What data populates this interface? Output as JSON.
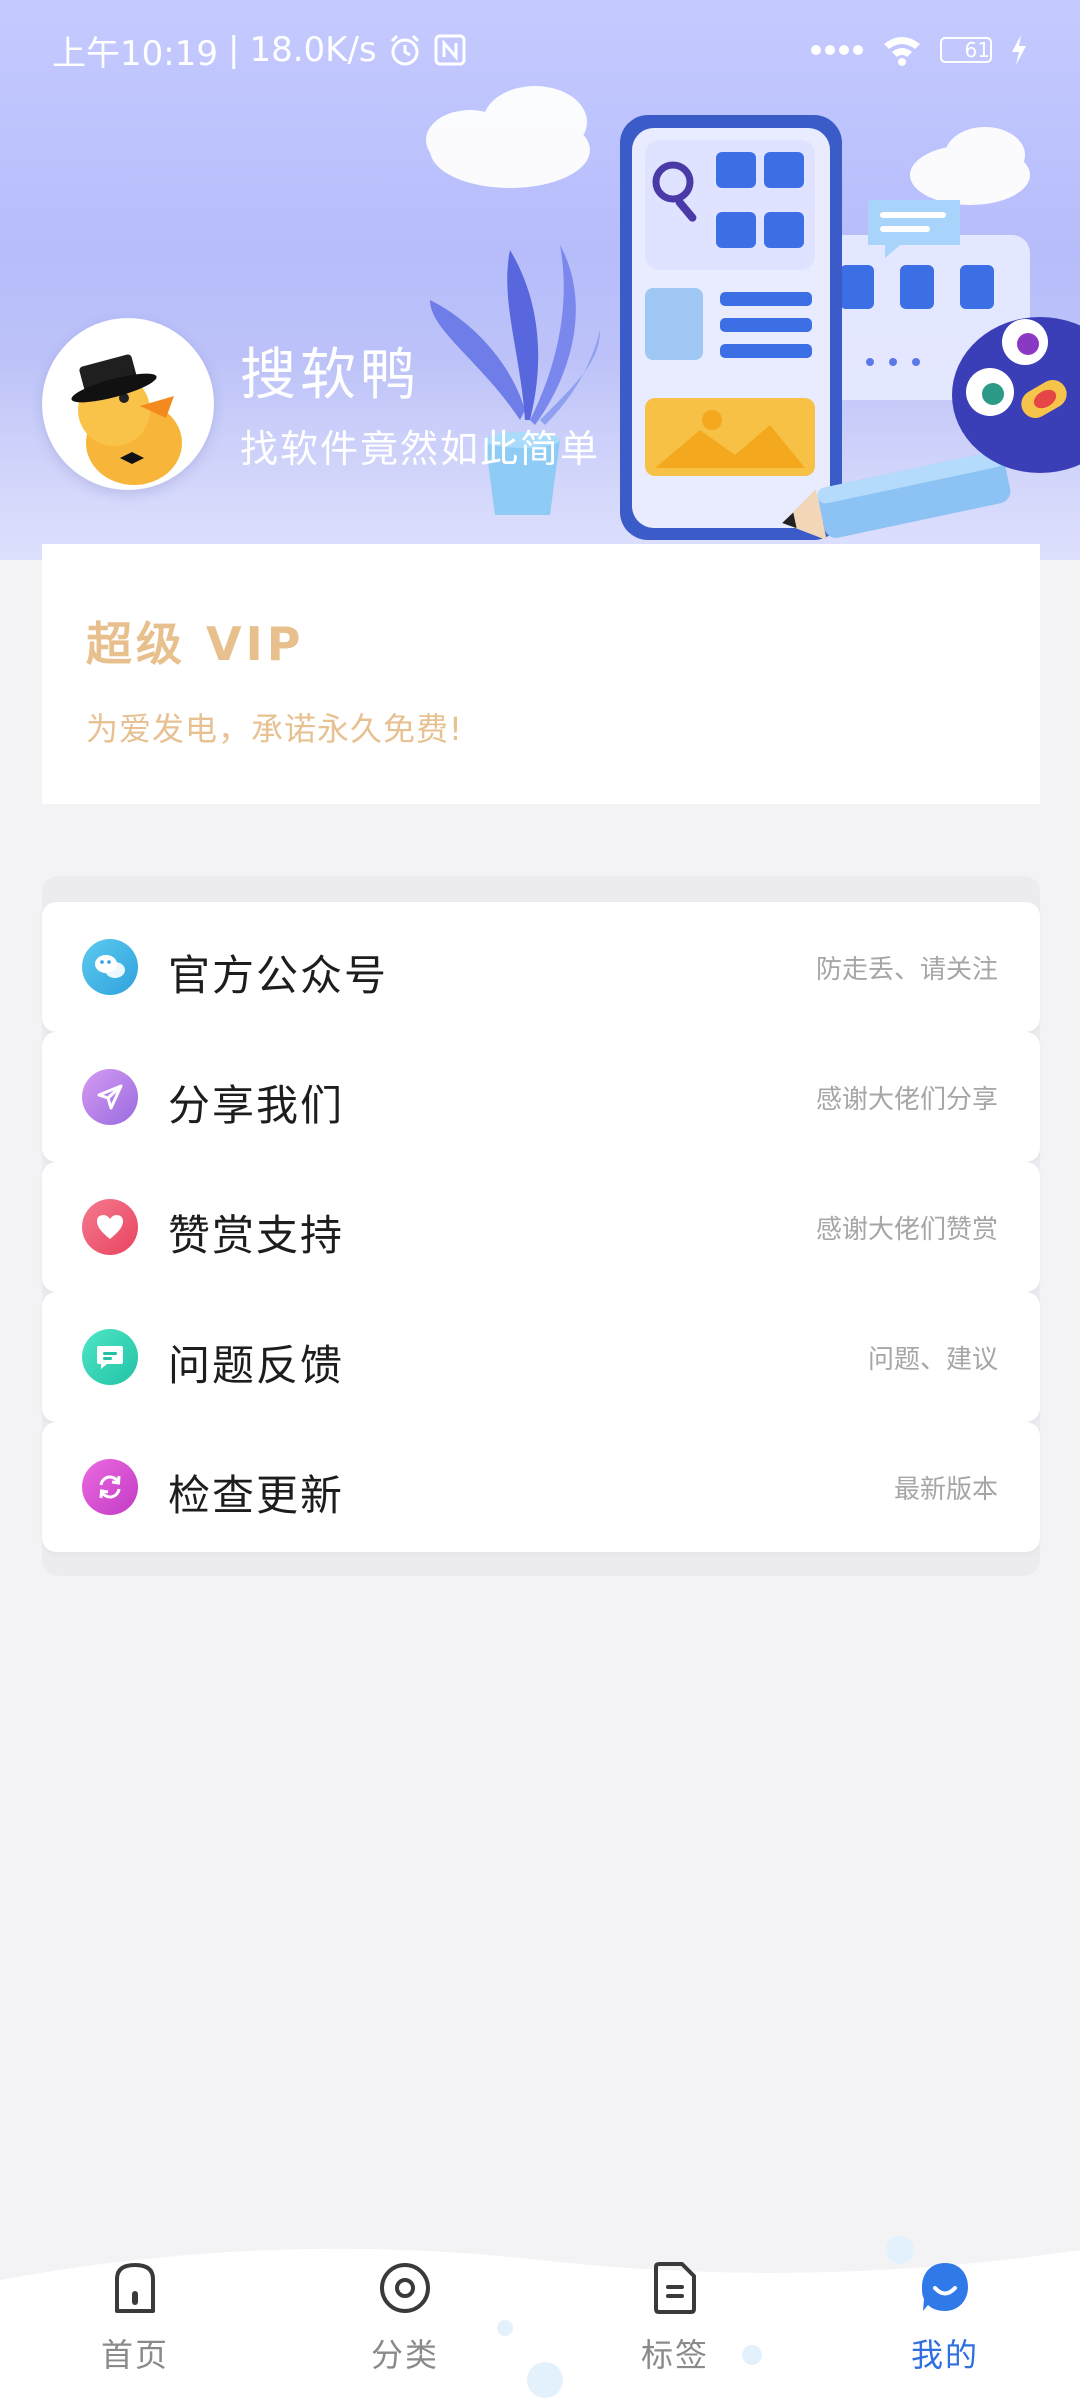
{
  "status_bar": {
    "time": "上午10:19",
    "network_speed": "18.0K/s",
    "battery_level": "61",
    "icons": [
      "alarm-icon",
      "nfc-icon",
      "signal-icon",
      "wifi-icon",
      "battery-icon",
      "charging-icon"
    ]
  },
  "profile": {
    "name": "搜软鸭",
    "slogan": "找软件竟然如此简单"
  },
  "vip": {
    "title": "超级 VIP",
    "description": "为爱发电，承诺永久免费!"
  },
  "menu": {
    "items": [
      {
        "label": "官方公众号",
        "subtitle": "防走丢、请关注",
        "icon": "wechat-icon",
        "color": "#3fb7e6"
      },
      {
        "label": "分享我们",
        "subtitle": "感谢大佬们分享",
        "icon": "send-icon",
        "color": "#b07ae8"
      },
      {
        "label": "赞赏支持",
        "subtitle": "感谢大佬们赞赏",
        "icon": "heart-icon",
        "color": "#f25c7a"
      },
      {
        "label": "问题反馈",
        "subtitle": "问题、建议",
        "icon": "feedback-icon",
        "color": "#2fd6b4"
      },
      {
        "label": "检查更新",
        "subtitle": "最新版本",
        "icon": "refresh-icon",
        "color": "#d94fd0"
      }
    ]
  },
  "bottom_nav": {
    "items": [
      {
        "label": "首页",
        "icon": "home-icon",
        "active": false
      },
      {
        "label": "分类",
        "icon": "category-icon",
        "active": false
      },
      {
        "label": "标签",
        "icon": "tag-icon",
        "active": false
      },
      {
        "label": "我的",
        "icon": "profile-icon",
        "active": true
      }
    ],
    "active_color": "#2f6fe0",
    "inactive_color": "#8a8a8a"
  },
  "colors": {
    "header_gradient_top": "#c5caff",
    "vip_gold": "#e8c08e",
    "page_background": "#f3f3f5"
  }
}
